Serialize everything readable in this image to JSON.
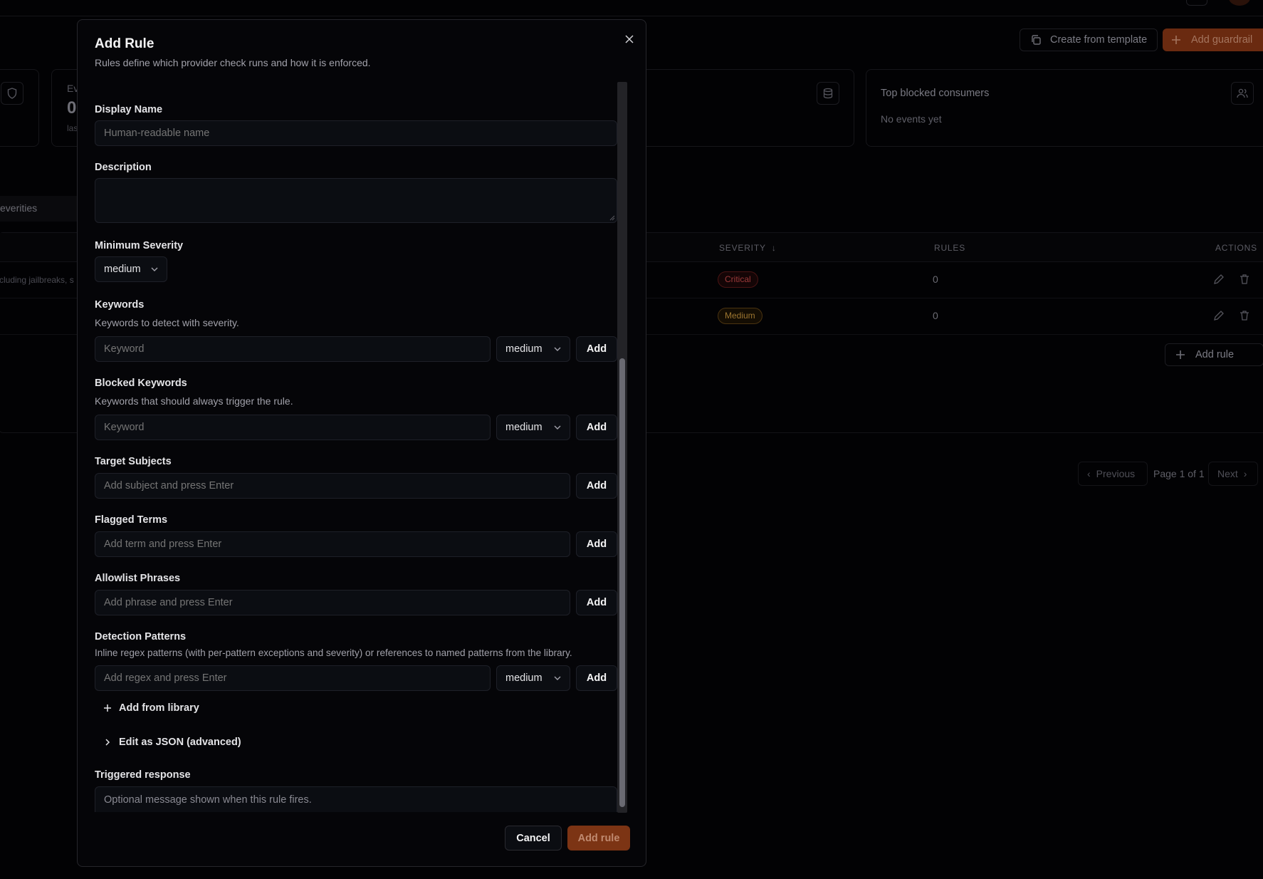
{
  "background": {
    "header_buttons": {
      "create_template": "Create from template",
      "add_guardrail": "Add guardrail"
    },
    "stats": [
      {
        "label": "Ev",
        "value": "0",
        "sub": "las"
      }
    ],
    "top_blocked": {
      "title": "Top blocked consumers",
      "empty": "No events yet"
    },
    "filter_label": "everities",
    "table": {
      "columns": [
        "SEVERITY",
        "RULES",
        "ACTIONS"
      ],
      "rows": [
        {
          "desc": "cluding jailbreaks, s",
          "severity": "Critical",
          "rules": "0"
        },
        {
          "desc": "",
          "severity": "Medium",
          "rules": "0"
        }
      ],
      "add_rule": "Add rule"
    },
    "pagination": {
      "previous": "Previous",
      "info": "Page 1 of 1",
      "next": "Next"
    }
  },
  "modal": {
    "title": "Add Rule",
    "subtitle": "Rules define which provider check runs and how it is enforced.",
    "fields": {
      "display_name": {
        "label": "Display Name",
        "placeholder": "Human-readable name"
      },
      "description": {
        "label": "Description",
        "value": ""
      },
      "min_severity": {
        "label": "Minimum Severity",
        "value": "medium"
      },
      "keywords": {
        "label": "Keywords",
        "hint": "Keywords to detect with severity.",
        "placeholder": "Keyword",
        "severity": "medium",
        "add": "Add"
      },
      "blocked_keywords": {
        "label": "Blocked Keywords",
        "hint": "Keywords that should always trigger the rule.",
        "placeholder": "Keyword",
        "severity": "medium",
        "add": "Add"
      },
      "target_subjects": {
        "label": "Target Subjects",
        "placeholder": "Add subject and press Enter",
        "add": "Add"
      },
      "flagged_terms": {
        "label": "Flagged Terms",
        "placeholder": "Add term and press Enter",
        "add": "Add"
      },
      "allowlist_phrases": {
        "label": "Allowlist Phrases",
        "placeholder": "Add phrase and press Enter",
        "add": "Add"
      },
      "detection_patterns": {
        "label": "Detection Patterns",
        "hint": "Inline regex patterns (with per-pattern exceptions and severity) or references to named patterns from the library.",
        "placeholder": "Add regex and press Enter",
        "severity": "medium",
        "add": "Add"
      },
      "add_from_library": "Add from library",
      "edit_json": "Edit as JSON (advanced)",
      "triggered_response": {
        "label": "Triggered response",
        "placeholder": "Optional message shown when this rule fires."
      }
    },
    "footer": {
      "cancel": "Cancel",
      "submit": "Add rule"
    }
  },
  "colors": {
    "accent": "#7c3414",
    "background": "#020204",
    "modal_bg": "#050508",
    "critical": "#9c3a3a",
    "medium": "#9c7530"
  }
}
